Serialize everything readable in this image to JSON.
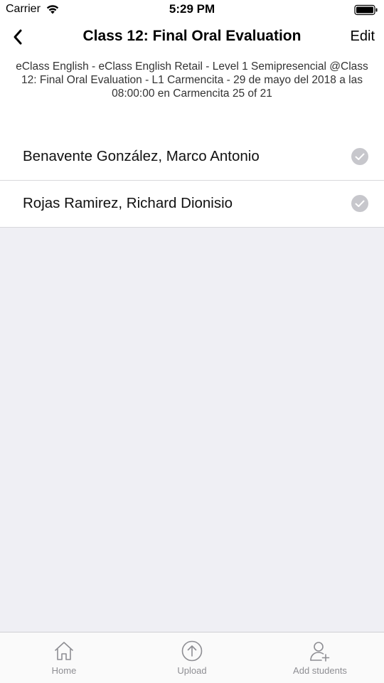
{
  "status_bar": {
    "carrier": "Carrier",
    "time": "5:29 PM"
  },
  "nav": {
    "title": "Class 12: Final Oral Evaluation",
    "edit_label": "Edit"
  },
  "header": {
    "subtitle": "eClass English - eClass English Retail -  Level 1 Semipresencial @Class 12: Final Oral Evaluation - L1 Carmencita - 29 de mayo del 2018 a las 08:00:00 en Carmencita 25 of 21"
  },
  "students": [
    {
      "name": "Benavente González, Marco Antonio"
    },
    {
      "name": "Rojas Ramirez, Richard Dionisio"
    }
  ],
  "tabs": {
    "home": "Home",
    "upload": "Upload",
    "add_students": "Add students"
  },
  "colors": {
    "background": "#efeff4",
    "check_circle": "#c7c7cc",
    "tab_icon": "#8e8e93"
  },
  "icons": [
    "wifi-icon",
    "battery-icon",
    "back-chevron-icon",
    "check-circle-icon",
    "home-icon",
    "upload-icon",
    "add-user-icon"
  ]
}
